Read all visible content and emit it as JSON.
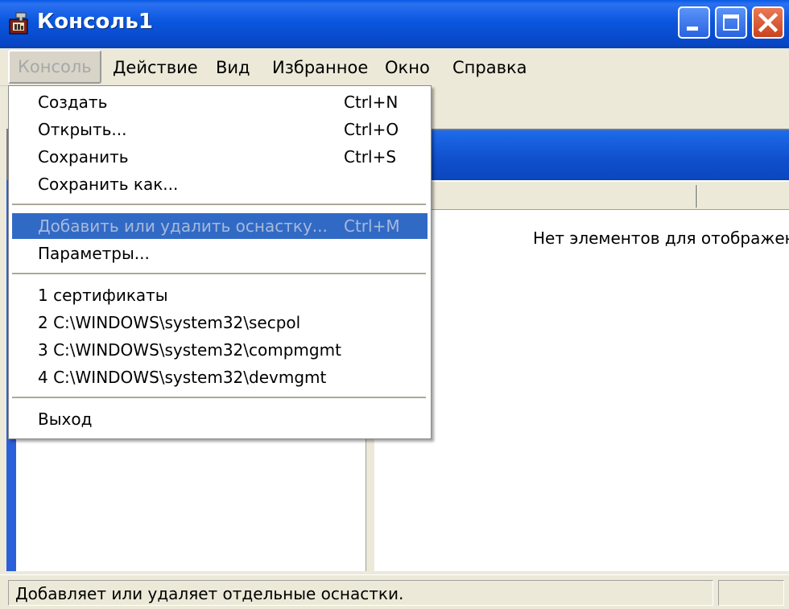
{
  "window": {
    "title": "Консоль1",
    "title_icon": "mmc-console-icon",
    "controls": [
      "minimize-icon",
      "maximize-icon",
      "close-icon"
    ]
  },
  "menubar": {
    "items": [
      "Консоль",
      "Действие",
      "Вид",
      "Избранное",
      "Окно",
      "Справка"
    ],
    "active": "Консоль"
  },
  "dropdown": {
    "items": [
      {
        "label": "Создать",
        "shortcut": "Ctrl+N"
      },
      {
        "label": "Открыть...",
        "shortcut": "Ctrl+O"
      },
      {
        "label": "Сохранить",
        "shortcut": "Ctrl+S"
      },
      {
        "label": "Сохранить как...",
        "shortcut": ""
      },
      {
        "label": "Добавить или удалить оснастку...",
        "shortcut": "Ctrl+M",
        "highlighted": true
      },
      {
        "label": "Параметры...",
        "shortcut": ""
      },
      {
        "label": "1 сертификаты",
        "shortcut": ""
      },
      {
        "label": "2 C:\\WINDOWS\\system32\\secpol",
        "shortcut": ""
      },
      {
        "label": "3 C:\\WINDOWS\\system32\\compmgmt",
        "shortcut": ""
      },
      {
        "label": "4 C:\\WINDOWS\\system32\\devmgmt",
        "shortcut": ""
      },
      {
        "label": "Выход",
        "shortcut": ""
      }
    ]
  },
  "content": {
    "empty_message": "Нет элементов для отображен"
  },
  "statusbar": {
    "text": "Добавляет или удаляет отдельные оснастки."
  },
  "colors": {
    "titlebar": "#0A56DE",
    "highlight": "#316AC5",
    "face": "#ECE9D8"
  }
}
